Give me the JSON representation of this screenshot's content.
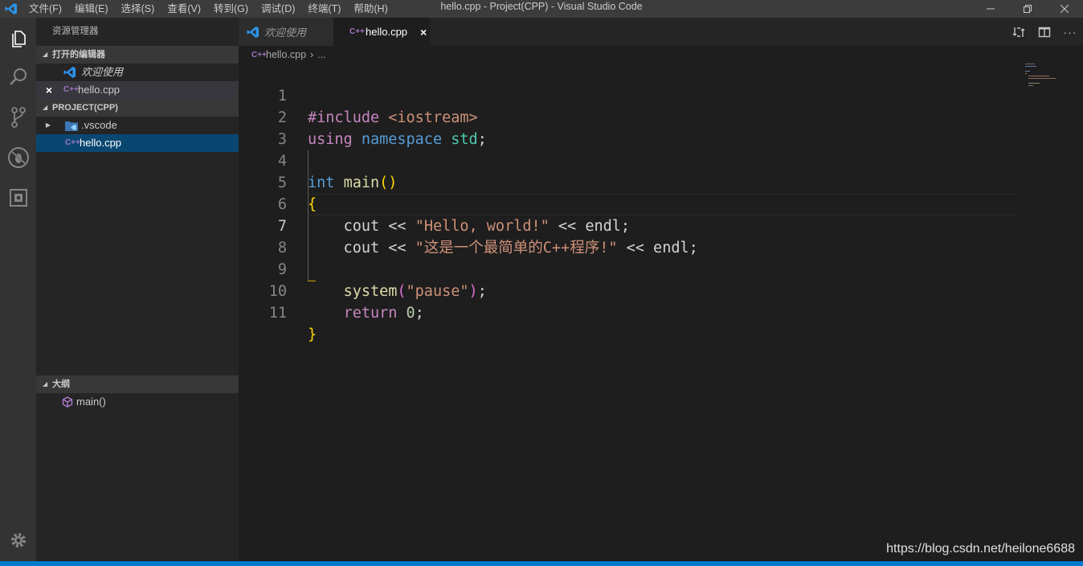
{
  "titlebar": {
    "menus": [
      "文件(F)",
      "编辑(E)",
      "选择(S)",
      "查看(V)",
      "转到(G)",
      "调试(D)",
      "终端(T)",
      "帮助(H)"
    ],
    "window_title": "hello.cpp - Project(CPP) - Visual Studio Code"
  },
  "activitybar": {
    "icons": [
      "files-icon",
      "search-icon",
      "source-control-icon",
      "debug-icon",
      "extensions-icon",
      "settings-gear-icon"
    ]
  },
  "sidebar": {
    "title": "资源管理器",
    "open_editors": {
      "header": "打开的编辑器",
      "items": [
        {
          "label": "欢迎使用",
          "icon": "vscode-icon"
        },
        {
          "label": "hello.cpp",
          "icon": "cpp-icon",
          "close": "×"
        }
      ]
    },
    "project": {
      "header": "PROJECT(CPP)",
      "items": [
        {
          "label": ".vscode",
          "icon": "folder-vscode-icon"
        },
        {
          "label": "hello.cpp",
          "icon": "cpp-icon"
        }
      ]
    },
    "outline": {
      "header": "大纲",
      "items": [
        {
          "label": "main()",
          "icon": "method-icon"
        }
      ]
    }
  },
  "tabs": [
    {
      "label": "欢迎使用",
      "active": false
    },
    {
      "label": "hello.cpp",
      "active": true,
      "close": "×"
    }
  ],
  "breadcrumb": {
    "file": "hello.cpp",
    "sep": "›",
    "more": "..."
  },
  "editor": {
    "line_numbers": [
      "1",
      "2",
      "3",
      "4",
      "5",
      "6",
      "7",
      "8",
      "9",
      "10",
      "11"
    ],
    "active_line": "7"
  },
  "watermark": "https://blog.csdn.net/heilone6688",
  "colors": {
    "accent": "#007acc",
    "selection": "#094771"
  }
}
